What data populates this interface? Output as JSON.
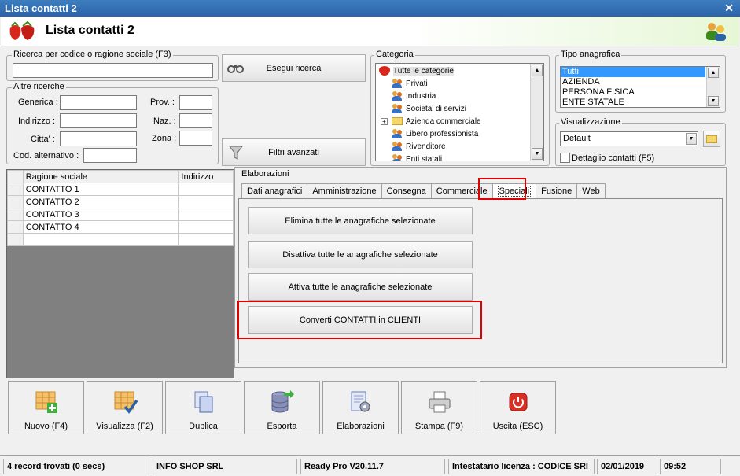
{
  "window": {
    "title": "Lista contatti 2",
    "header_title": "Lista contatti 2"
  },
  "search": {
    "legend": "Ricerca per codice o ragione sociale (F3)",
    "value": "",
    "search_button": "Esegui ricerca",
    "advanced_button": "Filtri avanzati"
  },
  "other_search": {
    "legend": "Altre ricerche",
    "generica_label": "Generica :",
    "indirizzo_label": "Indirizzo :",
    "citta_label": "Citta' :",
    "cod_alt_label": "Cod. alternativo :",
    "prov_label": "Prov. :",
    "naz_label": "Naz. :",
    "zona_label": "Zona :"
  },
  "categoria": {
    "legend": "Categoria",
    "items": [
      "Tutte le categorie",
      "Privati",
      "Industria",
      "Societa' di servizi",
      "Azienda commerciale",
      "Libero professionista",
      "Rivenditore",
      "Enti statali"
    ]
  },
  "tipo_anagrafica": {
    "legend": "Tipo anagrafica",
    "items": [
      "Tutti",
      "AZIENDA",
      "PERSONA FISICA",
      "ENTE STATALE"
    ],
    "selected": "Tutti"
  },
  "visualizzazione": {
    "legend": "Visualizzazione",
    "value": "Default",
    "dettaglio_label": "Dettaglio contatti (F5)",
    "dettaglio_checked": false
  },
  "grid": {
    "columns": [
      "Ragione sociale",
      "Indirizzo"
    ],
    "rows": [
      [
        "CONTATTO 1",
        ""
      ],
      [
        "CONTATTO 2",
        ""
      ],
      [
        "CONTATTO 3",
        ""
      ],
      [
        "CONTATTO 4",
        ""
      ]
    ]
  },
  "elaborazioni": {
    "legend": "Elaborazioni",
    "tabs": [
      "Dati anagrafici",
      "Amministrazione",
      "Consegna",
      "Commerciale",
      "Speciali",
      "Fusione",
      "Web"
    ],
    "active_tab": "Speciali",
    "actions": [
      "Elimina tutte le anagrafiche selezionate",
      "Disattiva tutte le anagrafiche selezionate",
      "Attiva tutte le anagrafiche selezionate",
      "Converti CONTATTI in CLIENTI"
    ]
  },
  "toolbar": {
    "buttons": [
      {
        "label": "Nuovo (F4)",
        "icon": "grid-add-icon"
      },
      {
        "label": "Visualizza (F2)",
        "icon": "grid-check-icon"
      },
      {
        "label": "Duplica",
        "icon": "duplicate-icon"
      },
      {
        "label": "Esporta",
        "icon": "database-export-icon"
      },
      {
        "label": "Elaborazioni",
        "icon": "document-gear-icon"
      },
      {
        "label": "Stampa (F9)",
        "icon": "printer-icon"
      },
      {
        "label": "Uscita (ESC)",
        "icon": "power-exit-icon"
      }
    ]
  },
  "status": {
    "records": "4 record trovati (0 secs)",
    "company": "INFO SHOP SRL",
    "version": "Ready Pro V20.11.7",
    "license": "Intestatario licenza : CODICE SRI",
    "date": "02/01/2019",
    "time": "09:52"
  },
  "colors": {
    "title_bar": "#2b63a8",
    "highlight": "#e00000",
    "selection": "#3399ff"
  }
}
